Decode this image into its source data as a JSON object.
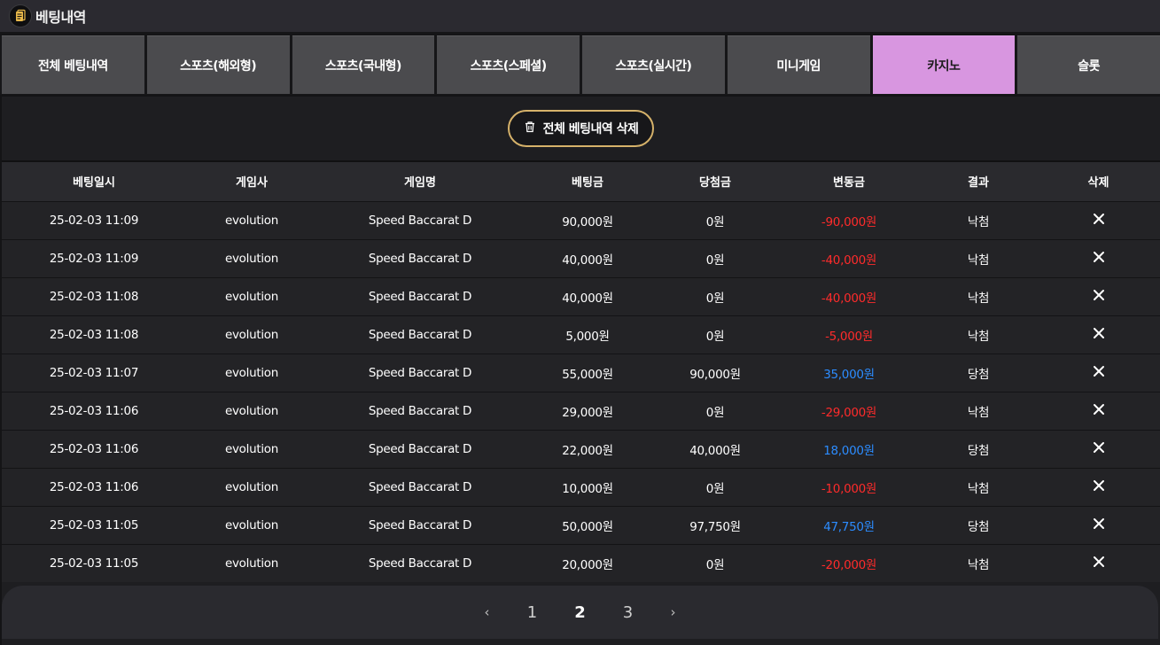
{
  "window": {
    "title": "베팅내역",
    "icon": "clipboard-icon"
  },
  "tabs": [
    {
      "label": "전체 베팅내역",
      "active": false
    },
    {
      "label": "스포츠(해외형)",
      "active": false
    },
    {
      "label": "스포츠(국내형)",
      "active": false
    },
    {
      "label": "스포츠(스페셜)",
      "active": false
    },
    {
      "label": "스포츠(실시간)",
      "active": false
    },
    {
      "label": "미니게임",
      "active": false
    },
    {
      "label": "카지노",
      "active": true
    },
    {
      "label": "슬롯",
      "active": false
    }
  ],
  "toolbar": {
    "delete_all_label": "전체 베팅내역 삭제",
    "delete_all_icon": "trash-icon"
  },
  "table": {
    "headers": [
      "베팅일시",
      "게임사",
      "게임명",
      "베팅금",
      "당첨금",
      "변동금",
      "결과",
      "삭제"
    ],
    "rows": [
      {
        "datetime": "25-02-03 11:09",
        "provider": "evolution",
        "game": "Speed Baccarat D",
        "bet": "90,000원",
        "win": "0원",
        "change": "-90,000원",
        "result": "낙첨"
      },
      {
        "datetime": "25-02-03 11:09",
        "provider": "evolution",
        "game": "Speed Baccarat D",
        "bet": "40,000원",
        "win": "0원",
        "change": "-40,000원",
        "result": "낙첨"
      },
      {
        "datetime": "25-02-03 11:08",
        "provider": "evolution",
        "game": "Speed Baccarat D",
        "bet": "40,000원",
        "win": "0원",
        "change": "-40,000원",
        "result": "낙첨"
      },
      {
        "datetime": "25-02-03 11:08",
        "provider": "evolution",
        "game": "Speed Baccarat D",
        "bet": "5,000원",
        "win": "0원",
        "change": "-5,000원",
        "result": "낙첨"
      },
      {
        "datetime": "25-02-03 11:07",
        "provider": "evolution",
        "game": "Speed Baccarat D",
        "bet": "55,000원",
        "win": "90,000원",
        "change": "35,000원",
        "result": "당첨"
      },
      {
        "datetime": "25-02-03 11:06",
        "provider": "evolution",
        "game": "Speed Baccarat D",
        "bet": "29,000원",
        "win": "0원",
        "change": "-29,000원",
        "result": "낙첨"
      },
      {
        "datetime": "25-02-03 11:06",
        "provider": "evolution",
        "game": "Speed Baccarat D",
        "bet": "22,000원",
        "win": "40,000원",
        "change": "18,000원",
        "result": "당첨"
      },
      {
        "datetime": "25-02-03 11:06",
        "provider": "evolution",
        "game": "Speed Baccarat D",
        "bet": "10,000원",
        "win": "0원",
        "change": "-10,000원",
        "result": "낙첨"
      },
      {
        "datetime": "25-02-03 11:05",
        "provider": "evolution",
        "game": "Speed Baccarat D",
        "bet": "50,000원",
        "win": "97,750원",
        "change": "47,750원",
        "result": "당첨"
      },
      {
        "datetime": "25-02-03 11:05",
        "provider": "evolution",
        "game": "Speed Baccarat D",
        "bet": "20,000원",
        "win": "0원",
        "change": "-20,000원",
        "result": "낙첨"
      }
    ]
  },
  "pagination": {
    "prev": "‹",
    "next": "›",
    "pages": [
      "1",
      "2",
      "3"
    ],
    "current": "2"
  },
  "colors": {
    "active_tab": "#d896e0",
    "loss": "#ff2b2b",
    "gain": "#2c8cff",
    "button_border": "#d6b26a"
  }
}
